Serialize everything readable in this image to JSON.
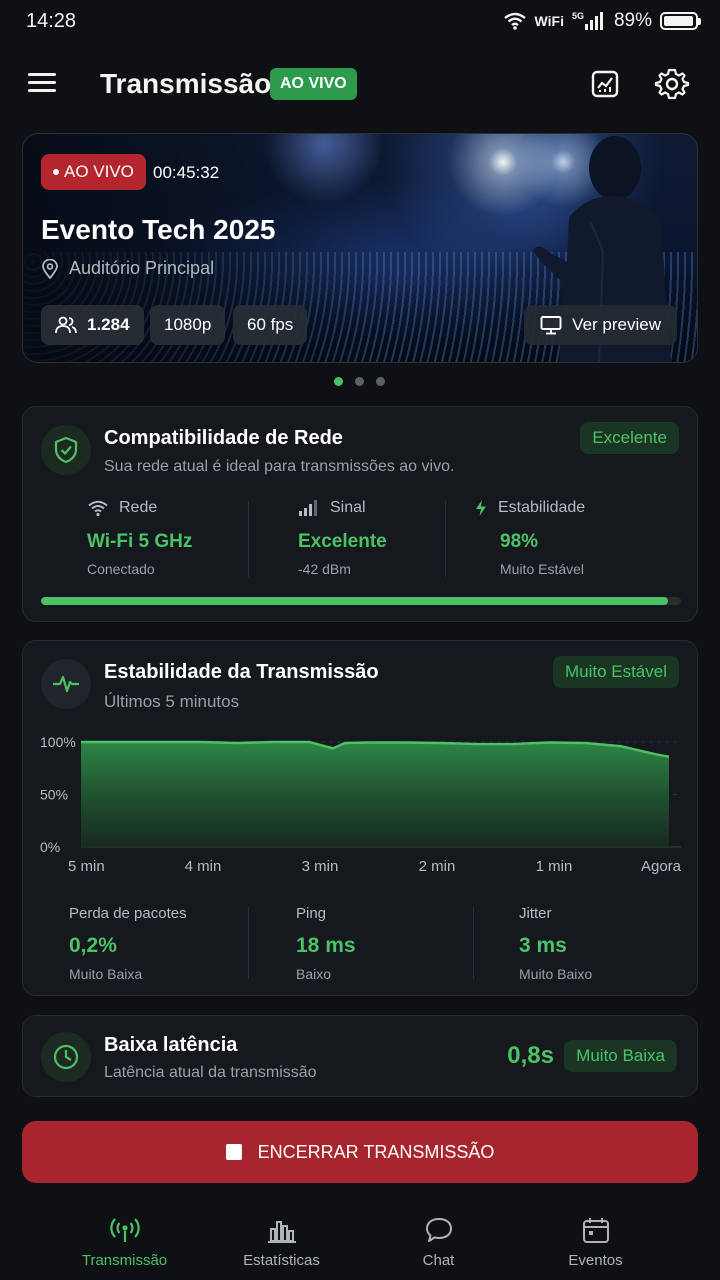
{
  "status_bar": {
    "time": "14:28",
    "wifi_label": "WiFi",
    "network": "5G",
    "battery": "89%"
  },
  "header": {
    "title": "Transmissão",
    "live_badge": "AO VIVO",
    "icons": [
      "menu-icon",
      "stats-icon",
      "settings-icon"
    ]
  },
  "hero": {
    "live_label": "AO VIVO",
    "elapsed": "00:45:32",
    "title": "Evento Tech 2025",
    "location": "Auditório Principal",
    "viewers": "1.284",
    "resolution": "1080p",
    "fps": "60 fps",
    "preview_label": "Ver preview",
    "carousel_page": 1,
    "carousel_total": 3
  },
  "network_card": {
    "title": "Compatibilidade de Rede",
    "subtitle": "Sua rede atual é ideal para transmissões ao vivo.",
    "badge": "Excelente",
    "stats": [
      {
        "label": "Rede",
        "value": "Wi-Fi 5 GHz",
        "sub": "Conectado",
        "icon": "wifi-icon"
      },
      {
        "label": "Sinal",
        "value": "Excelente",
        "sub": "-42 dBm",
        "icon": "signal-icon"
      },
      {
        "label": "Estabilidade",
        "value": "98%",
        "sub": "Muito Estável",
        "icon": "bolt-icon"
      }
    ],
    "progress": 0.98
  },
  "stability_card": {
    "title": "Estabilidade da Transmissão",
    "subtitle": "Últimos 5 minutos",
    "badge": "Muito Estável",
    "stats": [
      {
        "label": "Perda de pacotes",
        "value": "0,2%",
        "sub": "Muito Baixa"
      },
      {
        "label": "Ping",
        "value": "18 ms",
        "sub": "Baixo"
      },
      {
        "label": "Jitter",
        "value": "3 ms",
        "sub": "Muito Baixo"
      }
    ]
  },
  "chart_data": {
    "type": "area",
    "title": "Estabilidade da Transmissão",
    "xlabel": "",
    "ylabel": "",
    "x_ticks": [
      "5 min",
      "4 min",
      "3 min",
      "2 min",
      "1 min",
      "Agora"
    ],
    "y_ticks": [
      "100%",
      "50%",
      "0%"
    ],
    "ylim": [
      0,
      100
    ],
    "xlim": [
      0,
      5
    ],
    "grid": true,
    "series": [
      {
        "x": [
          0,
          0.5,
          1,
          1.3,
          1.6,
          1.9,
          2.0,
          2.1,
          2.2,
          2.4,
          2.7,
          3.0,
          3.3,
          3.6,
          3.9,
          4.2,
          4.5,
          4.8,
          4.9
        ],
        "values": [
          100,
          100,
          100,
          99,
          100,
          100,
          97,
          94,
          99,
          99.5,
          99.5,
          99,
          98,
          98,
          99.5,
          99,
          96,
          88,
          86
        ]
      }
    ],
    "color": "#4cc266"
  },
  "latency_card": {
    "title": "Baixa latência",
    "subtitle": "Latência atual da transmissão",
    "value": "0,8s",
    "badge": "Muito Baixa"
  },
  "end_button": "ENCERRAR TRANSMISSÃO",
  "bottom_nav": [
    {
      "label": "Transmissão",
      "icon": "broadcast-icon",
      "active": true
    },
    {
      "label": "Estatísticas",
      "icon": "bar-chart-icon",
      "active": false
    },
    {
      "label": "Chat",
      "icon": "chat-icon",
      "active": false
    },
    {
      "label": "Eventos",
      "icon": "calendar-icon",
      "active": false
    }
  ],
  "colors": {
    "accent": "#4cc266",
    "danger": "#a7262e",
    "background": "#0e1014",
    "card": "#15181d"
  }
}
